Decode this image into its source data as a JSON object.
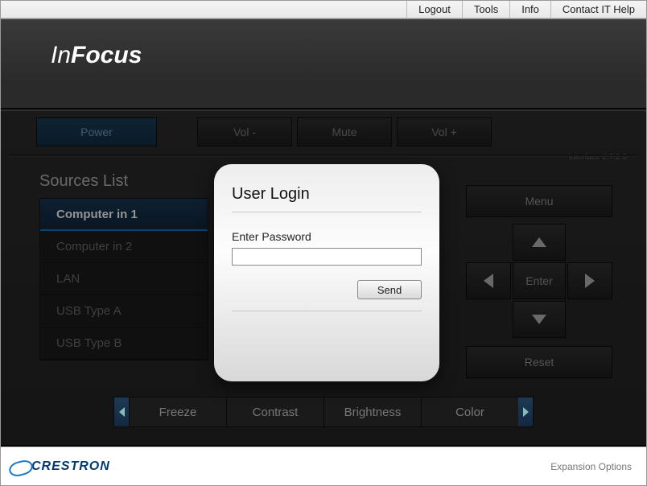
{
  "topbar": {
    "logout": "Logout",
    "tools": "Tools",
    "info": "Info",
    "contact": "Contact IT Help"
  },
  "brand": {
    "part1": "In",
    "part2": "Focus"
  },
  "controls": {
    "power": "Power",
    "vol_down": "Vol -",
    "mute": "Mute",
    "vol_up": "Vol +"
  },
  "version": "Interface 2.7.2.6",
  "sources": {
    "title": "Sources List",
    "items": [
      "Computer in 1",
      "Computer in 2",
      "LAN",
      "USB Type A",
      "USB Type B"
    ],
    "active_index": 0
  },
  "menupad": {
    "menu": "Menu",
    "enter": "Enter",
    "reset": "Reset"
  },
  "bottom_tabs": [
    "Freeze",
    "Contrast",
    "Brightness",
    "Color"
  ],
  "footer": {
    "brand": "CRESTRON",
    "expansion": "Expansion Options"
  },
  "login": {
    "title": "User Login",
    "label": "Enter Password",
    "value": "",
    "send": "Send"
  }
}
